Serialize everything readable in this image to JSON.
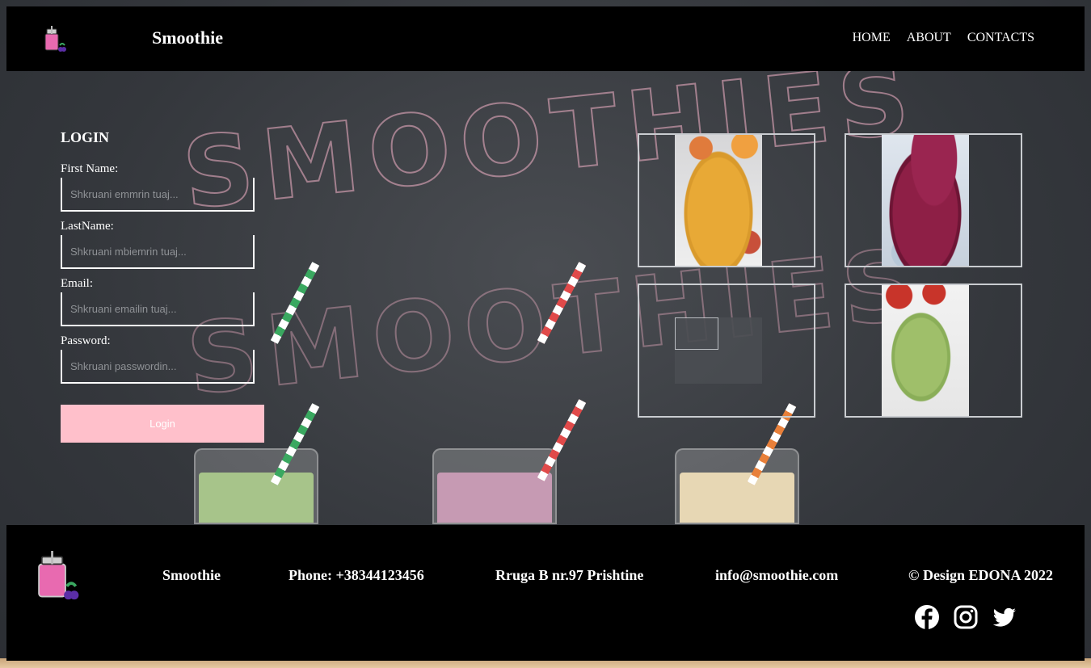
{
  "header": {
    "brand": "Smoothie",
    "nav": [
      "HOME",
      "ABOUT",
      "CONTACTS"
    ]
  },
  "login": {
    "title": "LOGIN",
    "fields": [
      {
        "label": "First Name:",
        "placeholder": "Shkruani emmrin tuaj..."
      },
      {
        "label": "LastName:",
        "placeholder": "Shkruani mbiemrin tuaj..."
      },
      {
        "label": "Email:",
        "placeholder": "Shkruani emailin tuaj..."
      },
      {
        "label": "Password:",
        "placeholder": "Shkruani passwordin..."
      }
    ],
    "button": "Login"
  },
  "footer": {
    "brand": "Smoothie",
    "phone": "Phone: +38344123456",
    "address": "Rruga B nr.97 Prishtine",
    "email": "info@smoothie.com",
    "copyright": "© Design EDONA 2022",
    "social_icons": [
      "facebook-icon",
      "instagram-icon",
      "twitter-icon"
    ]
  },
  "colors": {
    "accent": "#ffc0cb",
    "bar": "#000000"
  }
}
